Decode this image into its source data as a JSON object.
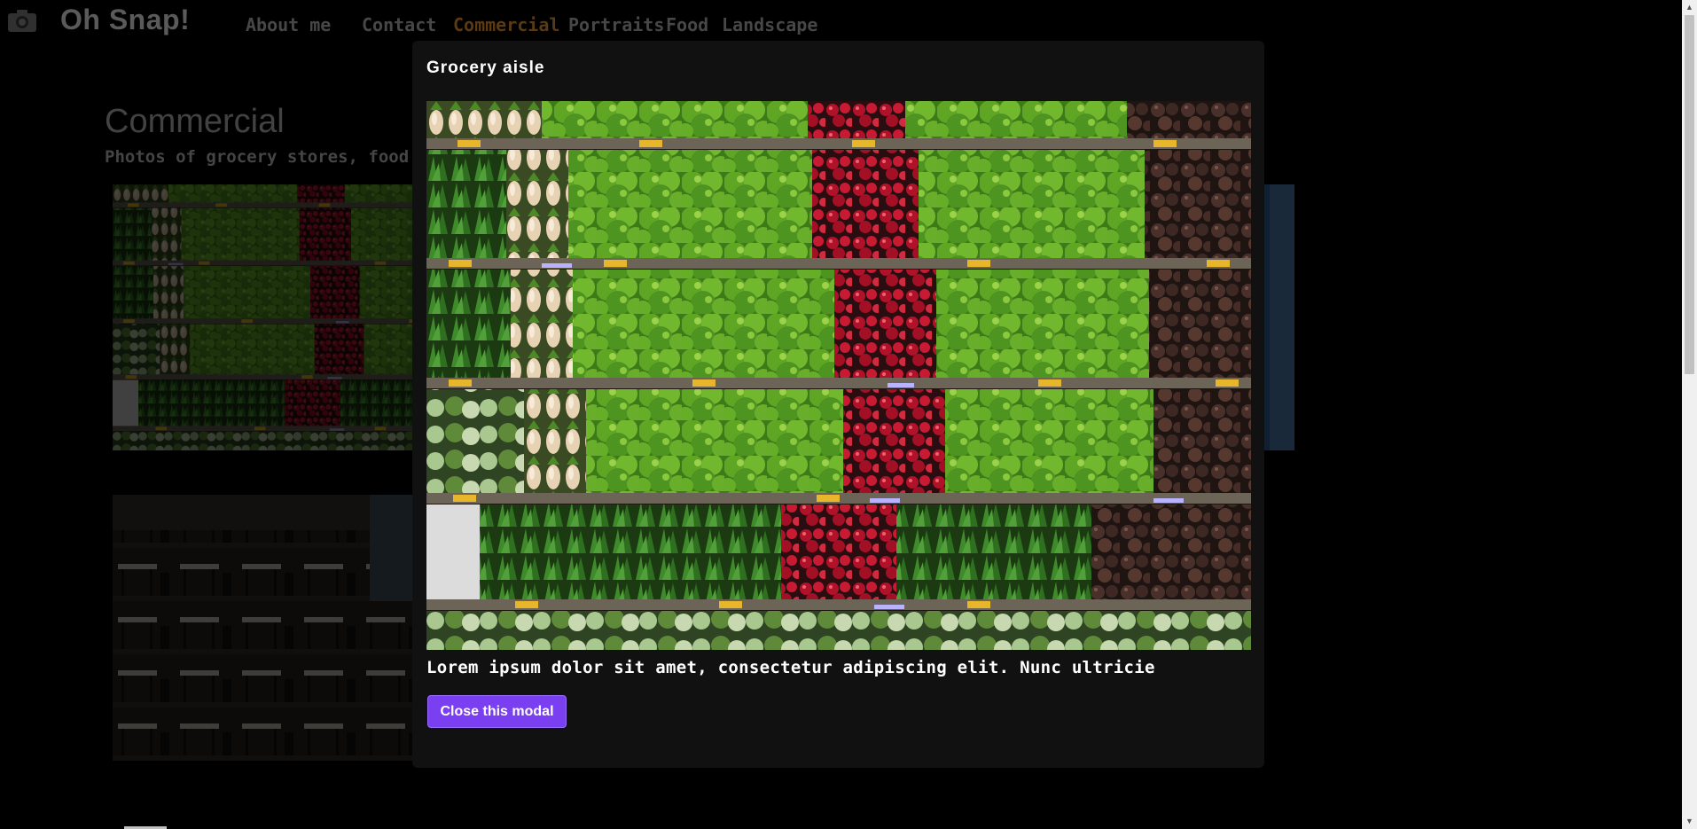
{
  "site": {
    "logo_text": "Oh Snap!",
    "logo_icon": "camera-icon"
  },
  "nav": {
    "items": [
      {
        "label": "About me",
        "active": false
      },
      {
        "label": "Contact",
        "active": false
      },
      {
        "label": "Commercial",
        "active": true
      },
      {
        "label": "Portraits",
        "active": false
      },
      {
        "label": "Food",
        "active": false
      },
      {
        "label": "Landscape",
        "active": false
      }
    ]
  },
  "page": {
    "title": "Commercial",
    "subtitle": "Photos of grocery stores, food tr"
  },
  "modal": {
    "title": "Grocery aisle",
    "description": "Lorem ipsum dolor sit amet, consectetur adipiscing elit. Nunc ultricie",
    "close_label": "Close this modal"
  },
  "colors": {
    "accent_button": "#7b3ff2",
    "active_nav": "#8a5a1f",
    "modal_bg": "#111111",
    "page_bg": "#000000"
  }
}
